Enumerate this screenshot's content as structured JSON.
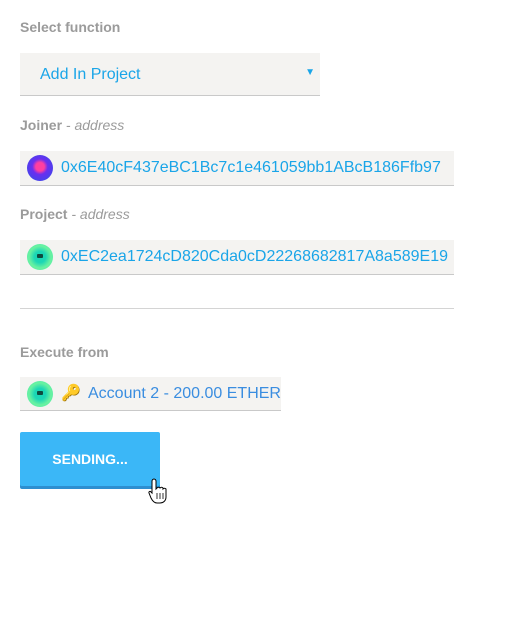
{
  "form": {
    "select_function_label": "Select function",
    "selected_function": "Add In Project",
    "joiner_label": "Joiner",
    "joiner_sub": " - address",
    "joiner_address": "0x6E40cF437eBC1Bc7c1e461059bb1ABcB186Ffb97",
    "project_label": "Project",
    "project_sub": " - address",
    "project_address": "0xEC2ea1724cD820Cda0cD22268682817A8a589E19",
    "execute_from_label": "Execute from",
    "account_text": "Account 2 - 200.00 ETHER",
    "send_button": "SENDING..."
  },
  "icons": {
    "dropdown": "chevron-down-icon",
    "joiner_identicon": "identicon-icon",
    "project_identicon": "identicon-icon",
    "account_identicon": "identicon-icon",
    "key": "key-icon",
    "cursor": "hand-pointer-icon"
  },
  "colors": {
    "accent": "#1aa5e8",
    "button": "#3bb7f7",
    "label": "#9b9b9b",
    "field_bg": "#f4f3f1"
  }
}
